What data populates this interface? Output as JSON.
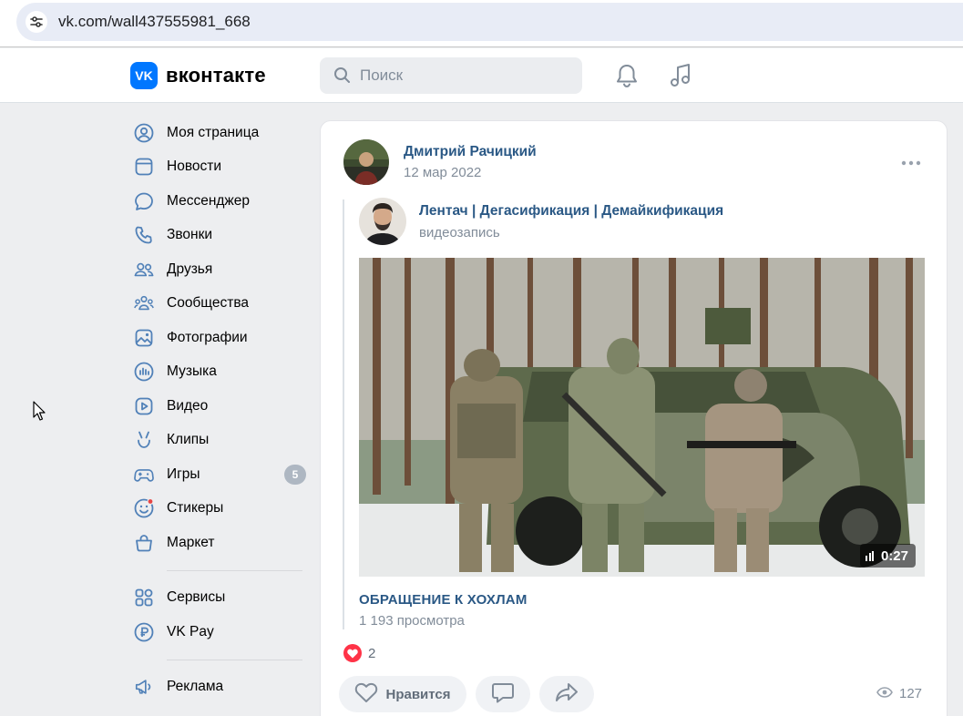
{
  "browser": {
    "url": "vk.com/wall437555981_668"
  },
  "header": {
    "logo_mark": "VK",
    "logo_text": "вконтакте",
    "search_placeholder": "Поиск",
    "icons": [
      "bell-icon",
      "music-icon"
    ]
  },
  "nav": {
    "items": [
      {
        "label": "Моя страница",
        "icon": "profile-icon"
      },
      {
        "label": "Новости",
        "icon": "news-icon"
      },
      {
        "label": "Мессенджер",
        "icon": "messenger-icon"
      },
      {
        "label": "Звонки",
        "icon": "phone-icon"
      },
      {
        "label": "Друзья",
        "icon": "friends-icon"
      },
      {
        "label": "Сообщества",
        "icon": "communities-icon"
      },
      {
        "label": "Фотографии",
        "icon": "photos-icon"
      },
      {
        "label": "Музыка",
        "icon": "music-icon"
      },
      {
        "label": "Видео",
        "icon": "video-icon"
      },
      {
        "label": "Клипы",
        "icon": "clips-icon"
      },
      {
        "label": "Игры",
        "icon": "games-icon",
        "badge": "5"
      },
      {
        "label": "Стикеры",
        "icon": "stickers-icon"
      },
      {
        "label": "Маркет",
        "icon": "market-icon"
      }
    ],
    "secondary": [
      {
        "label": "Сервисы",
        "icon": "services-icon"
      },
      {
        "label": "VK Pay",
        "icon": "vkpay-icon"
      }
    ],
    "tertiary": [
      {
        "label": "Реклама",
        "icon": "ads-icon"
      }
    ]
  },
  "post": {
    "author": "Дмитрий Рачицкий",
    "date": "12 мар 2022",
    "repost": {
      "source": "Лентач | Дегасификация | Демайкификация",
      "type": "видеозапись"
    },
    "video": {
      "duration": "0:27",
      "title": "ОБРАЩЕНИЕ К ХОХЛАМ",
      "views": "1 193 просмотра"
    },
    "reactions_count": "2",
    "like_label": "Нравится",
    "views_count": "127"
  },
  "colors": {
    "accent": "#0077ff",
    "link": "#2a5885",
    "muted": "#818c99",
    "reaction": "#ff3347"
  }
}
